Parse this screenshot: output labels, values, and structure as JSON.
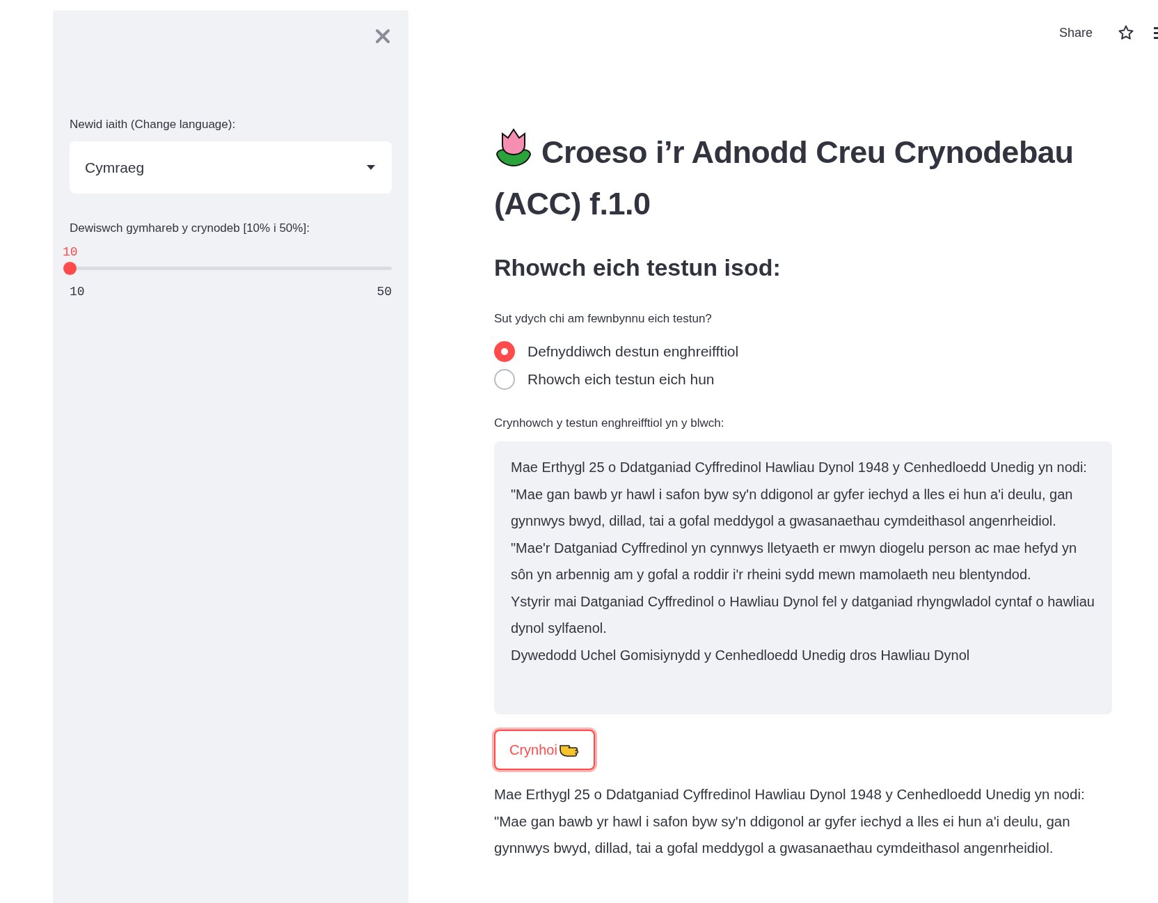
{
  "toolbar": {
    "share": "Share"
  },
  "sidebar": {
    "language_select": {
      "label": "Newid iaith (Change language):",
      "value": "Cymraeg"
    },
    "ratio_slider": {
      "label": "Dewiswch gymhareb y crynodeb [10% i 50%]:",
      "value": "10",
      "min": "10",
      "max": "50",
      "level": 0
    }
  },
  "main": {
    "title": "Croeso i’r Adnodd Creu Crynodebau (ACC) f.1.0",
    "subtitle": "Rhowch eich testun isod:",
    "input_method": {
      "label": "Sut ydych chi am fewnbynnu eich testun?",
      "options": [
        {
          "label": "Defnyddiwch destun enghreifftiol",
          "selected": true
        },
        {
          "label": "Rhowch eich testun eich hun",
          "selected": false
        }
      ]
    },
    "text_area": {
      "label": "Crynhowch y testun enghreifftiol yn y blwch:",
      "paragraphs": [
        "Mae Erthygl 25 o Ddatganiad Cyffredinol Hawliau Dynol 1948 y Cenhedloedd Unedig yn nodi: \"Mae gan bawb yr hawl i safon byw sy'n ddigonol ar gyfer iechyd a lles ei hun a'i deulu, gan gynnwys bwyd, dillad, tai a gofal meddygol a gwasanaethau cymdeithasol angenrheidiol.",
        "\"Mae'r Datganiad Cyffredinol yn cynnwys lletyaeth er mwyn diogelu person ac mae hefyd yn sôn yn arbennig am y gofal a roddir i'r rheini sydd mewn mamolaeth neu blentyndod.",
        "Ystyrir mai Datganiad Cyffredinol o Hawliau Dynol fel y datganiad rhyngwladol cyntaf o hawliau dynol sylfaenol.",
        "Dywedodd Uchel Gomisiynydd y Cenhedloedd Unedig dros Hawliau Dynol"
      ]
    },
    "button": "Crynhoi",
    "summary": "Mae Erthygl 25 o Ddatganiad Cyffredinol Hawliau Dynol 1948 y Cenhedloedd Unedig yn nodi: \"Mae gan bawb yr hawl i safon byw sy'n ddigonol ar gyfer iechyd a lles ei hun a'i deulu, gan gynnwys bwyd, dillad, tai a gofal meddygol a gwasanaethau cymdeithasol angenrheidiol."
  }
}
